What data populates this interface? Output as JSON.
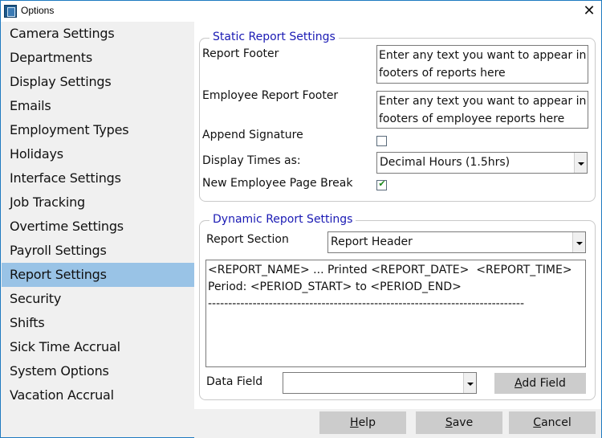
{
  "window": {
    "title": "Options",
    "close_label": "✕"
  },
  "sidebar": {
    "items": [
      {
        "label": "Camera Settings"
      },
      {
        "label": "Departments"
      },
      {
        "label": "Display Settings"
      },
      {
        "label": "Emails"
      },
      {
        "label": "Employment Types"
      },
      {
        "label": "Holidays"
      },
      {
        "label": "Interface Settings"
      },
      {
        "label": "Job Tracking"
      },
      {
        "label": "Overtime Settings"
      },
      {
        "label": "Payroll Settings"
      },
      {
        "label": "Report Settings",
        "selected": true
      },
      {
        "label": "Security"
      },
      {
        "label": "Shifts"
      },
      {
        "label": "Sick Time Accrual"
      },
      {
        "label": "System Options"
      },
      {
        "label": "Vacation Accrual"
      }
    ]
  },
  "static_report": {
    "title": "Static Report Settings",
    "report_footer_label": "Report Footer",
    "report_footer_value": "Enter any text you want to appear in footers of reports here",
    "employee_footer_label": "Employee Report Footer",
    "employee_footer_value": "Enter any text you want to appear in footers of employee reports here",
    "append_signature_label": "Append Signature",
    "append_signature_checked": false,
    "display_times_label": "Display Times as:",
    "display_times_value": "Decimal Hours (1.5hrs)",
    "page_break_label": "New Employee Page Break",
    "page_break_checked": true,
    "check_glyph": "✔"
  },
  "dynamic_report": {
    "title": "Dynamic Report Settings",
    "report_section_label": "Report Section",
    "report_section_value": "Report Header",
    "template_text": "<REPORT_NAME> ... Printed <REPORT_DATE>  <REPORT_TIME>\nPeriod: <PERIOD_START> to <PERIOD_END>\n------------------------------------------------------------------------------",
    "data_field_label": "Data Field",
    "data_field_value": "",
    "add_field_label": "Add Field",
    "add_field_mnemonic": "A",
    "add_field_rest": "dd Field"
  },
  "footer": {
    "help_mnemonic": "H",
    "help_rest": "elp",
    "save_mnemonic": "S",
    "save_rest": "ave",
    "cancel_mnemonic": "C",
    "cancel_rest": "ancel"
  }
}
